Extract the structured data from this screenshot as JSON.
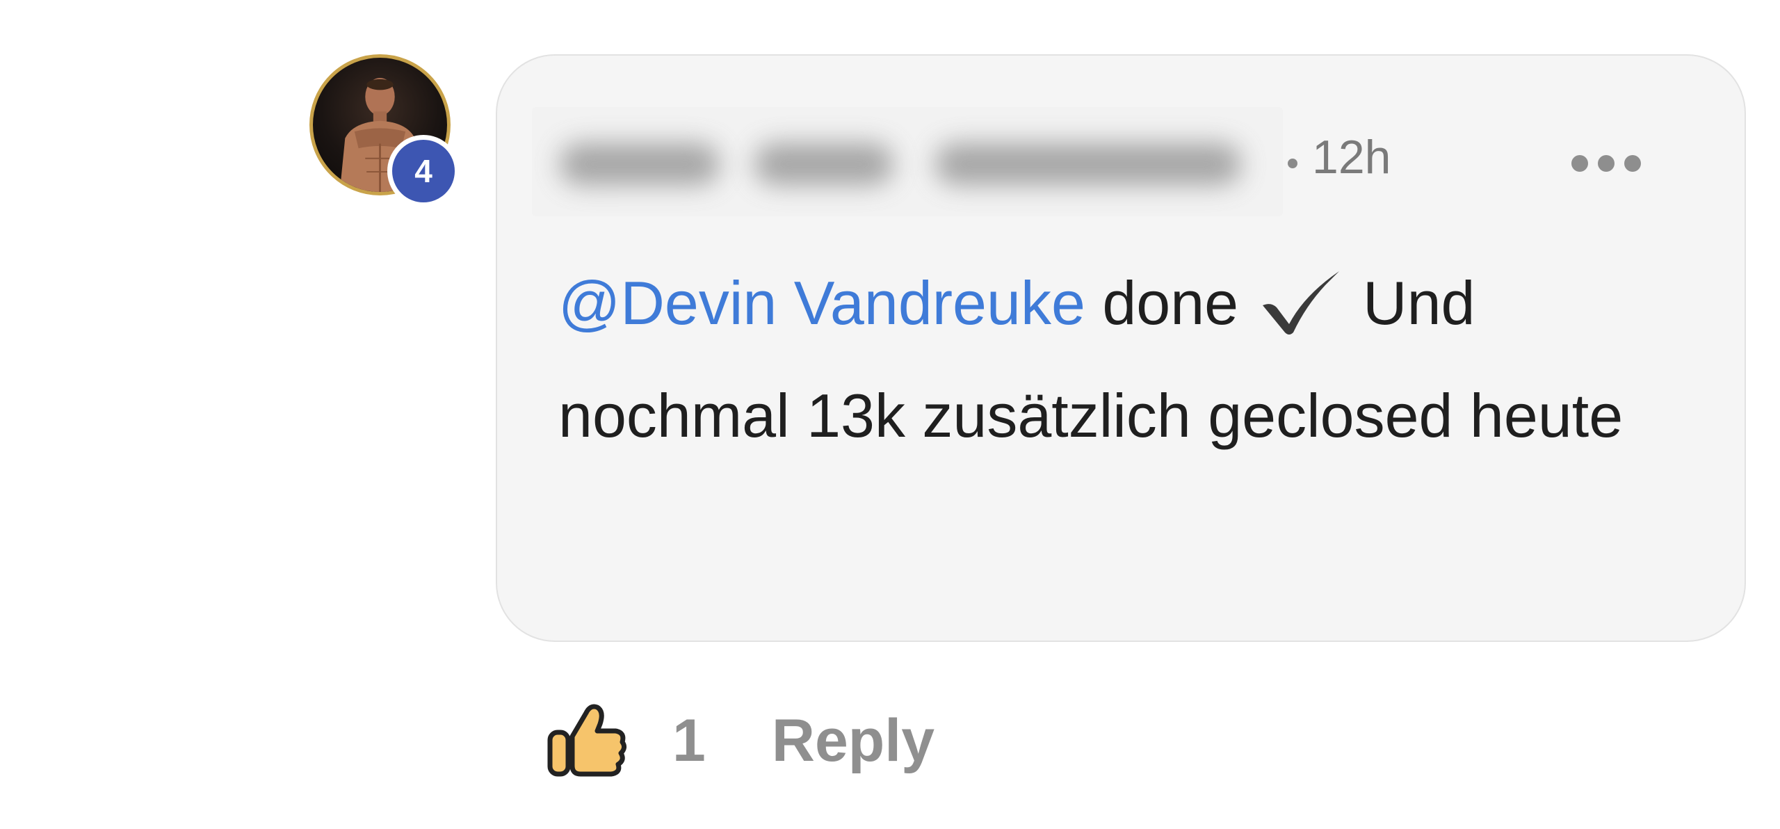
{
  "comment": {
    "author_level": "4",
    "author_name_redacted": true,
    "separator": "•",
    "timestamp": "12h",
    "more_icon": "more-horizontal-icon",
    "mention": "@Devin Vandreuke",
    "text_before_check": " done ",
    "check_icon": "check-mark-icon",
    "text_after_check": " Und nochmal 13k zusätzlich geclosed heute"
  },
  "actions": {
    "like_icon": "thumbs-up-icon",
    "like_count": "1",
    "reply_label": "Reply"
  },
  "colors": {
    "mention": "#3f7bd8",
    "badge": "#3d56b2",
    "avatar_ring": "#c9a34a",
    "bubble_bg": "#f5f5f5",
    "muted_text": "#8f8f8f",
    "like_fill": "#f6c46b"
  }
}
